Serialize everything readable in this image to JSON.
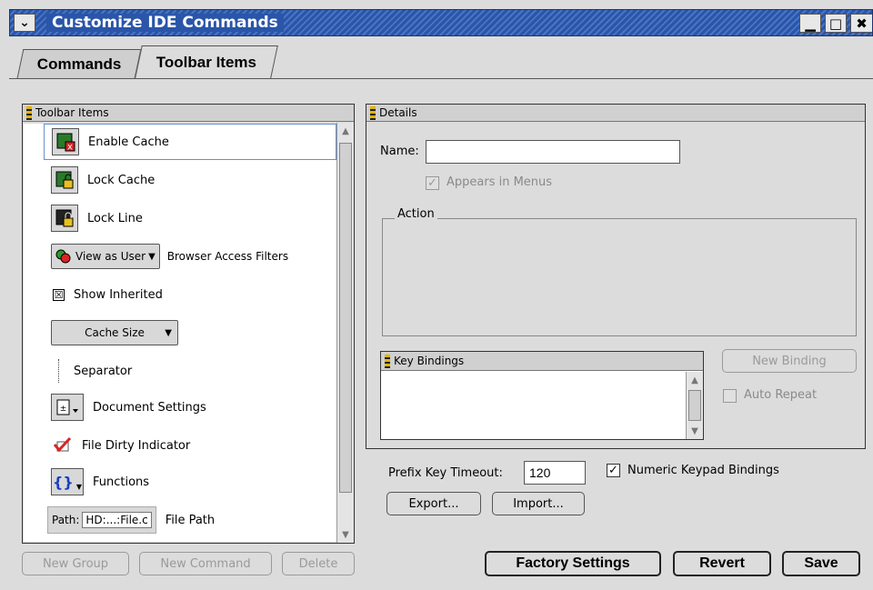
{
  "window": {
    "title": "Customize IDE Commands",
    "menu_glyph": "⌄",
    "minimize_glyph": "▁",
    "maximize_glyph": "□",
    "close_glyph": "✖"
  },
  "tabs": [
    {
      "label": "Commands",
      "active": false
    },
    {
      "label": "Toolbar Items",
      "active": true
    }
  ],
  "toolbar_panel": {
    "header": "Toolbar Items",
    "items": [
      {
        "label": "Enable Cache",
        "icon": "enable-cache-icon",
        "selected": true
      },
      {
        "label": "Lock Cache",
        "icon": "lock-cache-icon"
      },
      {
        "label": "Lock Line",
        "icon": "lock-line-icon"
      },
      {
        "label": "Browser Access Filters",
        "button": "View as User",
        "icon": "view-as-user-icon"
      },
      {
        "label": "Show Inherited",
        "checkbox": "☒"
      },
      {
        "label": "",
        "button": "Cache Size"
      },
      {
        "label": "Separator"
      },
      {
        "label": "Document Settings",
        "icon": "document-settings-icon"
      },
      {
        "label": "File Dirty Indicator",
        "icon": "file-dirty-icon"
      },
      {
        "label": "Functions",
        "icon": "functions-icon",
        "glyph": "{}"
      },
      {
        "label": "File Path",
        "path_label": "Path:",
        "path_value": "HD:...:File.c"
      }
    ],
    "buttons": {
      "new_group": "New Group",
      "new_command": "New Command",
      "delete": "Delete"
    }
  },
  "details_panel": {
    "header": "Details",
    "name_label": "Name:",
    "name_value": "",
    "appears_in_menus": "Appears in Menus",
    "action_label": "Action",
    "key_bindings_header": "Key Bindings",
    "new_binding": "New Binding",
    "auto_repeat": "Auto Repeat"
  },
  "bottom": {
    "prefix_key_label": "Prefix Key Timeout:",
    "prefix_key_value": "120",
    "numeric_keypad": "Numeric Keypad Bindings",
    "export": "Export...",
    "import": "Import...",
    "factory_settings": "Factory Settings",
    "revert": "Revert",
    "save": "Save"
  }
}
